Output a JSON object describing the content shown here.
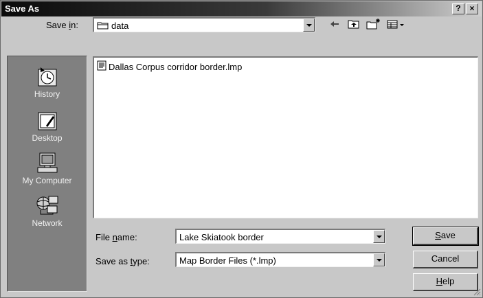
{
  "window": {
    "title": "Save As",
    "help_btn": "?",
    "close_btn": "×"
  },
  "save_in": {
    "label_pre": "Save ",
    "label_key": "i",
    "label_post": "n:",
    "value": "data",
    "icon": "folder-icon"
  },
  "toolbar": {
    "back_icon": "back-arrow-icon",
    "up_icon": "up-folder-icon",
    "new_folder_icon": "new-folder-icon",
    "view_icon": "view-menu-icon"
  },
  "places": [
    {
      "label": "History",
      "icon": "history-icon"
    },
    {
      "label": "Desktop",
      "icon": "desktop-icon"
    },
    {
      "label": "My Computer",
      "icon": "my-computer-icon"
    },
    {
      "label": "Network",
      "icon": "network-icon"
    }
  ],
  "files": [
    {
      "name": "Dallas Corpus corridor border.lmp",
      "icon": "document-icon"
    }
  ],
  "file_name": {
    "label_pre": "File ",
    "label_key": "n",
    "label_post": "ame:",
    "value": "Lake Skiatook border"
  },
  "file_type": {
    "label_pre": "Save as ",
    "label_key": "t",
    "label_post": "ype:",
    "value": "Map Border Files (*.lmp)"
  },
  "buttons": {
    "save_key": "S",
    "save_rest": "ave",
    "cancel": "Cancel",
    "help_key": "H",
    "help_rest": "elp"
  }
}
